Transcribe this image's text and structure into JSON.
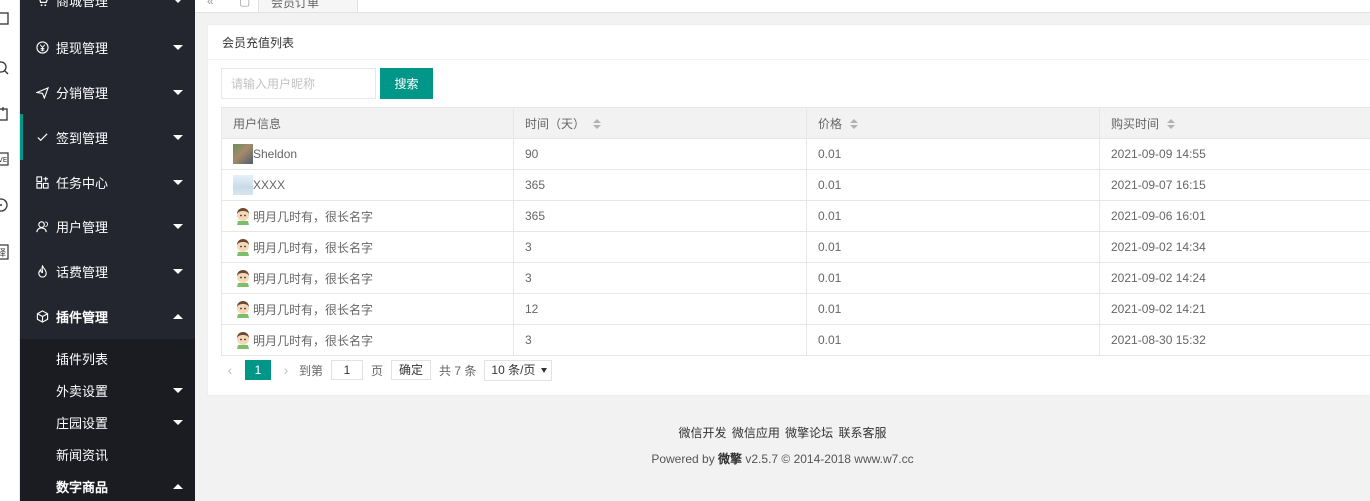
{
  "sidebar": {
    "items": [
      {
        "label": "商城管理",
        "icon": "cart-icon"
      },
      {
        "label": "提现管理",
        "icon": "yen-icon"
      },
      {
        "label": "分销管理",
        "icon": "send-icon"
      },
      {
        "label": "签到管理",
        "icon": "check-icon"
      },
      {
        "label": "任务中心",
        "icon": "tasks-icon"
      },
      {
        "label": "用户管理",
        "icon": "users-icon"
      },
      {
        "label": "话费管理",
        "icon": "flame-icon"
      },
      {
        "label": "插件管理",
        "icon": "cube-icon"
      }
    ],
    "sub_items": [
      {
        "label": "插件列表"
      },
      {
        "label": "外卖设置"
      },
      {
        "label": "庄园设置"
      },
      {
        "label": "新闻资讯"
      },
      {
        "label": "数字商品"
      }
    ]
  },
  "tabstrip": {
    "nav_back": "«",
    "nav_home": "▢",
    "active_tab": "会员订单"
  },
  "card": {
    "title": "会员充值列表",
    "search_placeholder": "请输入用户昵称",
    "search_button": "搜索"
  },
  "table": {
    "headers": [
      "用户信息",
      "时间（天）",
      "价格",
      "购买时间"
    ],
    "rows": [
      {
        "user": "Sheldon",
        "days": "90",
        "price": "0.01",
        "bought": "2021-09-09 14:55",
        "avatar": "photo"
      },
      {
        "user": "XXXX",
        "days": "365",
        "price": "0.01",
        "bought": "2021-09-07 16:15",
        "avatar": "sky"
      },
      {
        "user": "明月几时有，很长名字",
        "days": "365",
        "price": "0.01",
        "bought": "2021-09-06 16:01",
        "avatar": "cartoon"
      },
      {
        "user": "明月几时有，很长名字",
        "days": "3",
        "price": "0.01",
        "bought": "2021-09-02 14:34",
        "avatar": "cartoon"
      },
      {
        "user": "明月几时有，很长名字",
        "days": "3",
        "price": "0.01",
        "bought": "2021-09-02 14:24",
        "avatar": "cartoon"
      },
      {
        "user": "明月几时有，很长名字",
        "days": "12",
        "price": "0.01",
        "bought": "2021-09-02 14:21",
        "avatar": "cartoon"
      },
      {
        "user": "明月几时有，很长名字",
        "days": "3",
        "price": "0.01",
        "bought": "2021-08-30 15:32",
        "avatar": "cartoon"
      }
    ]
  },
  "pager": {
    "prev": "‹",
    "current": "1",
    "next": "›",
    "goto_label": "到第",
    "goto_value": "1",
    "page_unit": "页",
    "confirm": "确定",
    "total": "共 7 条",
    "per_page": "10 条/页"
  },
  "footer": {
    "links": [
      "微信开发",
      "微信应用",
      "微擎论坛",
      "联系客服"
    ],
    "powered_prefix": "Powered by ",
    "brand": "微擎",
    "powered_suffix": " v2.5.7 © 2014-2018 www.w7.cc"
  },
  "colors": {
    "sidebar_bg": "#23262e",
    "accent": "#009688"
  }
}
